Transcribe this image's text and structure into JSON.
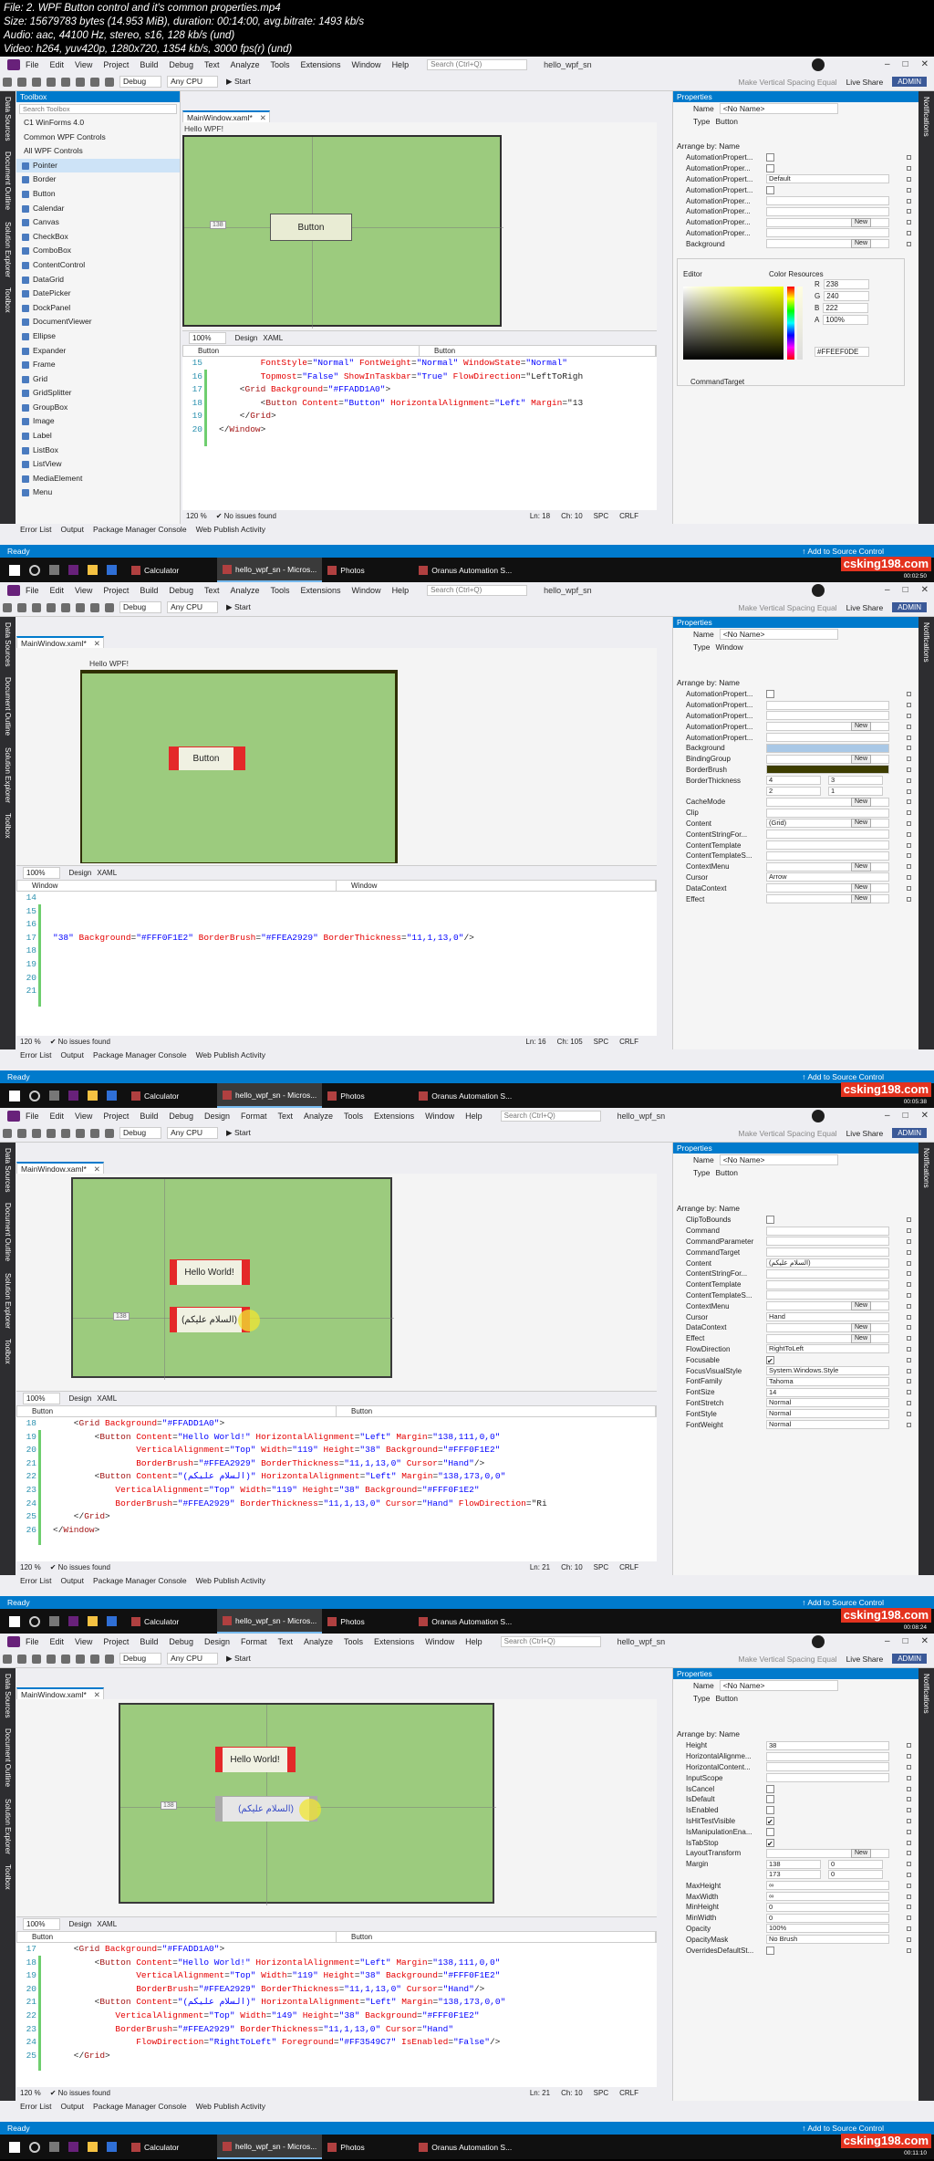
{
  "header": {
    "file_line": "File: 2. WPF Button control and it's common properties.mp4",
    "size_line": "Size: 15679783 bytes (14.953 MiB), duration: 00:14:00, avg.bitrate: 1493 kb/s",
    "audio_line": "Audio: aac, 44100 Hz, stereo, s16, 128 kb/s (und)",
    "video_line": "Video: h264, yuv420p, 1280x720, 1354 kb/s, 3000 fps(r) (und)"
  },
  "common": {
    "menu": [
      "File",
      "Edit",
      "View",
      "Project",
      "Build",
      "Debug",
      "Text",
      "Analyze",
      "Tools",
      "Extensions",
      "Window",
      "Help"
    ],
    "menu_design": [
      "File",
      "Edit",
      "View",
      "Project",
      "Build",
      "Debug",
      "Design",
      "Format",
      "Text",
      "Analyze",
      "Tools",
      "Extensions",
      "Window",
      "Help"
    ],
    "search_placeholder": "Search (Ctrl+Q)",
    "project_name": "hello_wpf_sn",
    "debug": "Debug",
    "cpu": "Any CPU",
    "start": "Start",
    "vertical_spacing": "Make Vertical Spacing Equal",
    "live_share": "Live Share",
    "admin": "ADMIN",
    "left_side_tabs": [
      "Data Sources",
      "Document Outline",
      "Solution Explorer",
      "Toolbox"
    ],
    "right_side_tab": "Notifications",
    "bottom_tabs": [
      "Error List",
      "Output",
      "Package Manager Console",
      "Web Publish Activity"
    ],
    "status_ready": "Ready",
    "add_source": "Add to Source Control",
    "zoom": "100%",
    "design_tab": "Design",
    "xaml_tab": "XAML",
    "code_zoom": "120 %",
    "no_issues": "No issues found",
    "spc": "SPC",
    "crlf": "CRLF",
    "taskbar_apps": [
      "Calculator",
      "hello_wpf_sn - Micros...",
      "Photos",
      "Oranus Automation S..."
    ],
    "watermark": "csking198.com",
    "properties_title": "Properties",
    "name_label": "Name",
    "name_value": "<No Name>",
    "type_label": "Type",
    "arrange_by": "Arrange by: Name",
    "new_label": "New"
  },
  "frames": [
    {
      "timestamp": "00:02:50",
      "doc_tab": "MainWindow.xaml*",
      "window_title": "Hello WPF!",
      "button_text": "Button",
      "margin_hint": "138",
      "nav_left": "Button",
      "nav_right": "Button",
      "code": [
        {
          "n": "15",
          "t": "        FontStyle=\"Normal\" FontWeight=\"Normal\" WindowState=\"Normal\""
        },
        {
          "n": "16",
          "t": "        Topmost=\"False\" ShowInTaskbar=\"True\" FlowDirection=\"LeftToRigh"
        },
        {
          "n": "17",
          "t": "    <Grid Background=\"#FFADD1A0\">"
        },
        {
          "n": "18",
          "t": "        <Button Content=\"Button\" HorizontalAlignment=\"Left\" Margin=\"13"
        },
        {
          "n": "19",
          "t": "    </Grid>"
        },
        {
          "n": "20",
          "t": "</Window>"
        }
      ],
      "ln": "Ln: 18",
      "ch": "Ch: 10",
      "toolbox_title": "Toolbox",
      "toolbox_search": "Search Toolbox",
      "toolbox_items": [
        "C1 WinForms 4.0",
        "Common WPF Controls",
        "All WPF Controls",
        "Pointer",
        "Border",
        "Button",
        "Calendar",
        "Canvas",
        "CheckBox",
        "ComboBox",
        "ContentControl",
        "DataGrid",
        "DatePicker",
        "DockPanel",
        "DocumentViewer",
        "Ellipse",
        "Expander",
        "Frame",
        "Grid",
        "GridSplitter",
        "GroupBox",
        "Image",
        "Label",
        "ListBox",
        "ListView",
        "MediaElement",
        "Menu"
      ],
      "type_value": "Button",
      "props": [
        {
          "n": "AutomationPropert...",
          "k": "cb"
        },
        {
          "n": "AutomationProper...",
          "k": "cb"
        },
        {
          "n": "AutomationPropert...",
          "v": "Default"
        },
        {
          "n": "AutomationPropert...",
          "k": "cb"
        },
        {
          "n": "AutomationProper...",
          "v": ""
        },
        {
          "n": "AutomationProper...",
          "v": ""
        },
        {
          "n": "AutomationProper...",
          "v": "",
          "new": true
        },
        {
          "n": "AutomationProper...",
          "v": ""
        },
        {
          "n": "Background",
          "v": "",
          "new": true
        }
      ],
      "editor_label": "Editor",
      "color_resources": "Color Resources",
      "rgb": {
        "r": "238",
        "g": "240",
        "b": "222",
        "a": "100%"
      },
      "hex": "#FFEEF0DE",
      "last_prop": "CommandTarget"
    },
    {
      "timestamp": "00:05:38",
      "doc_tab": "MainWindow.xaml*",
      "window_title": "Hello WPF!",
      "button_text": "Button",
      "nav_left": "Window",
      "nav_right": "Window",
      "code": [
        {
          "n": "14",
          "t": ""
        },
        {
          "n": "15",
          "t": ""
        },
        {
          "n": "16",
          "t": ""
        },
        {
          "n": "17",
          "t": "\"38\" Background=\"#FFF0F1E2\" BorderBrush=\"#FFEA2929\" BorderThickness=\"11,1,13,0\"/>"
        },
        {
          "n": "18",
          "t": ""
        },
        {
          "n": "19",
          "t": ""
        },
        {
          "n": "20",
          "t": ""
        },
        {
          "n": "21",
          "t": ""
        }
      ],
      "ln": "Ln: 16",
      "ch": "Ch: 105",
      "type_value": "Window",
      "props": [
        {
          "n": "AutomationPropert...",
          "k": "cb"
        },
        {
          "n": "AutomationPropert...",
          "v": ""
        },
        {
          "n": "AutomationPropert...",
          "v": ""
        },
        {
          "n": "AutomationPropert...",
          "v": "",
          "new": true
        },
        {
          "n": "AutomationPropert...",
          "v": ""
        },
        {
          "n": "Background",
          "v": "",
          "sw": "#a9c8e6"
        },
        {
          "n": "BindingGroup",
          "v": "",
          "new": true
        },
        {
          "n": "BorderBrush",
          "v": "",
          "sw": "#3d3d00"
        },
        {
          "n": "BorderThickness",
          "v": "4",
          "v2": "3"
        },
        {
          "n": "",
          "v": "2",
          "v2": "1"
        },
        {
          "n": "CacheMode",
          "v": "",
          "new": true
        },
        {
          "n": "Clip",
          "v": ""
        },
        {
          "n": "Content",
          "v": "(Grid)",
          "new": true
        },
        {
          "n": "ContentStringFor...",
          "v": ""
        },
        {
          "n": "ContentTemplate",
          "v": ""
        },
        {
          "n": "ContentTemplateS...",
          "v": ""
        },
        {
          "n": "ContextMenu",
          "v": "",
          "new": true
        },
        {
          "n": "Cursor",
          "v": "Arrow"
        },
        {
          "n": "DataContext",
          "v": "",
          "new": true
        },
        {
          "n": "Effect",
          "v": "",
          "new": true
        }
      ]
    },
    {
      "timestamp": "00:08:24",
      "doc_tab": "MainWindow.xaml*",
      "buttons": [
        "Hello World!",
        "(السلام عليكم)"
      ],
      "margin_hint": "138",
      "nav_left": "Button",
      "nav_right": "Button",
      "code": [
        {
          "n": "18",
          "t": "    <Grid Background=\"#FFADD1A0\">"
        },
        {
          "n": "19",
          "t": "        <Button Content=\"Hello World!\" HorizontalAlignment=\"Left\" Margin=\"138,111,0,0\""
        },
        {
          "n": "20",
          "t": "                VerticalAlignment=\"Top\" Width=\"119\" Height=\"38\" Background=\"#FFF0F1E2\""
        },
        {
          "n": "21",
          "t": "                BorderBrush=\"#FFEA2929\" BorderThickness=\"11,1,13,0\" Cursor=\"Hand\"/>"
        },
        {
          "n": "22",
          "t": "        <Button Content=\"(السلام عليكم)\" HorizontalAlignment=\"Left\" Margin=\"138,173,0,0\""
        },
        {
          "n": "23",
          "t": "            VerticalAlignment=\"Top\" Width=\"119\" Height=\"38\" Background=\"#FFF0F1E2\""
        },
        {
          "n": "24",
          "t": "            BorderBrush=\"#FFEA2929\" BorderThickness=\"11,1,13,0\" Cursor=\"Hand\" FlowDirection=\"Ri"
        },
        {
          "n": "25",
          "t": "    </Grid>"
        },
        {
          "n": "26",
          "t": "</Window>"
        }
      ],
      "ln": "Ln: 21",
      "ch": "Ch: 10",
      "type_value": "Button",
      "props": [
        {
          "n": "ClipToBounds",
          "k": "cb"
        },
        {
          "n": "Command",
          "v": ""
        },
        {
          "n": "CommandParameter",
          "v": ""
        },
        {
          "n": "CommandTarget",
          "v": ""
        },
        {
          "n": "Content",
          "v": "(السلام عليكم)"
        },
        {
          "n": "ContentStringFor...",
          "v": ""
        },
        {
          "n": "ContentTemplate",
          "v": ""
        },
        {
          "n": "ContentTemplateS...",
          "v": ""
        },
        {
          "n": "ContextMenu",
          "v": "",
          "new": true
        },
        {
          "n": "Cursor",
          "v": "Hand"
        },
        {
          "n": "DataContext",
          "v": "",
          "new": true
        },
        {
          "n": "Effect",
          "v": "",
          "new": true
        },
        {
          "n": "FlowDirection",
          "v": "RightToLeft"
        },
        {
          "n": "Focusable",
          "k": "cbx"
        },
        {
          "n": "FocusVisualStyle",
          "v": "System.Windows.Style"
        },
        {
          "n": "FontFamily",
          "v": "Tahoma"
        },
        {
          "n": "FontSize",
          "v": "14"
        },
        {
          "n": "FontStretch",
          "v": "Normal"
        },
        {
          "n": "FontStyle",
          "v": "Normal"
        },
        {
          "n": "FontWeight",
          "v": "Normal"
        }
      ]
    },
    {
      "timestamp": "00:11:10",
      "doc_tab": "MainWindow.xaml*",
      "buttons": [
        "Hello World!",
        "(السلام عليكم)"
      ],
      "margin_hint": "138",
      "nav_left": "Button",
      "nav_right": "Button",
      "code": [
        {
          "n": "17",
          "t": "    <Grid Background=\"#FFADD1A0\">"
        },
        {
          "n": "18",
          "t": "        <Button Content=\"Hello World!\" HorizontalAlignment=\"Left\" Margin=\"138,111,0,0\""
        },
        {
          "n": "19",
          "t": "                VerticalAlignment=\"Top\" Width=\"119\" Height=\"38\" Background=\"#FFF0F1E2\""
        },
        {
          "n": "20",
          "t": "                BorderBrush=\"#FFEA2929\" BorderThickness=\"11,1,13,0\" Cursor=\"Hand\"/>"
        },
        {
          "n": "21",
          "t": "        <Button Content=\"(السلام عليكم)\" HorizontalAlignment=\"Left\" Margin=\"138,173,0,0\""
        },
        {
          "n": "22",
          "t": "            VerticalAlignment=\"Top\" Width=\"149\" Height=\"38\" Background=\"#FFF0F1E2\""
        },
        {
          "n": "23",
          "t": "            BorderBrush=\"#FFEA2929\" BorderThickness=\"11,1,13,0\" Cursor=\"Hand\""
        },
        {
          "n": "24",
          "t": "                FlowDirection=\"RightToLeft\" Foreground=\"#FF3549C7\" IsEnabled=\"False\"/>"
        },
        {
          "n": "25",
          "t": "    </Grid>"
        }
      ],
      "ln": "Ln: 21",
      "ch": "Ch: 10",
      "type_value": "Button",
      "props": [
        {
          "n": "Height",
          "v": "38"
        },
        {
          "n": "HorizontalAlignme...",
          "v": ""
        },
        {
          "n": "HorizontalContent...",
          "v": ""
        },
        {
          "n": "InputScope",
          "v": ""
        },
        {
          "n": "IsCancel",
          "k": "cb"
        },
        {
          "n": "IsDefault",
          "k": "cb"
        },
        {
          "n": "IsEnabled",
          "k": "cb"
        },
        {
          "n": "IsHitTestVisible",
          "k": "cbx"
        },
        {
          "n": "IsManipulationEna...",
          "k": "cb"
        },
        {
          "n": "IsTabStop",
          "k": "cbx"
        },
        {
          "n": "LayoutTransform",
          "v": "",
          "new": true
        },
        {
          "n": "Margin",
          "v": "138",
          "v2": "0"
        },
        {
          "n": "",
          "v": "173",
          "v2": "0"
        },
        {
          "n": "MaxHeight",
          "v": "∞"
        },
        {
          "n": "MaxWidth",
          "v": "∞"
        },
        {
          "n": "MinHeight",
          "v": "0"
        },
        {
          "n": "MinWidth",
          "v": "0"
        },
        {
          "n": "Opacity",
          "v": "100%"
        },
        {
          "n": "OpacityMask",
          "v": "No Brush"
        },
        {
          "n": "OverridesDefaultSt...",
          "k": "cb"
        }
      ]
    }
  ]
}
